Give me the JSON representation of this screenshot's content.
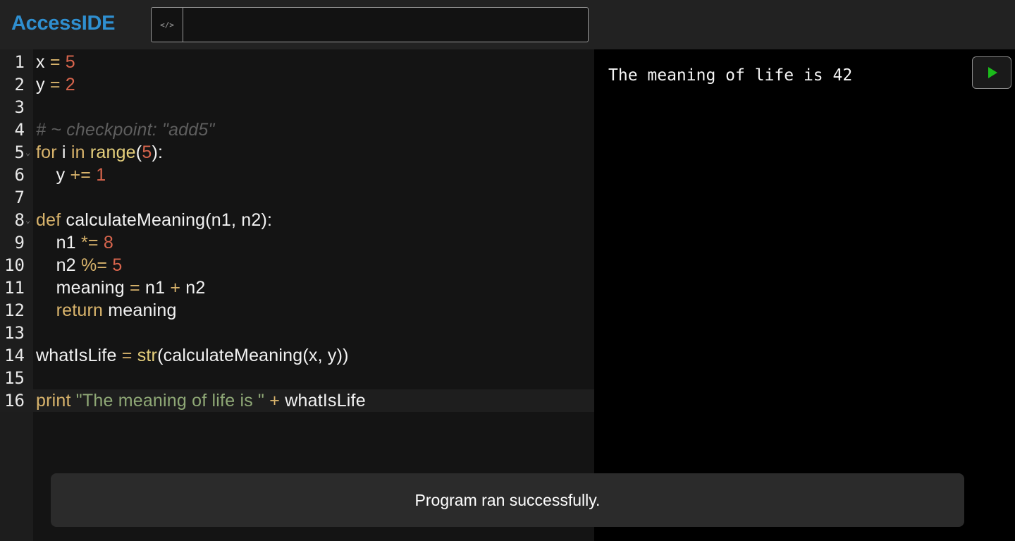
{
  "app": {
    "title": "AccessIDE"
  },
  "command_bar": {
    "icon": "code-icon",
    "icon_glyph": "</>",
    "value": "",
    "placeholder": ""
  },
  "editor": {
    "lines": [
      {
        "n": "1",
        "tokens": [
          {
            "t": "x",
            "c": "id"
          },
          {
            "t": " = ",
            "c": "op"
          },
          {
            "t": "5",
            "c": "num"
          }
        ]
      },
      {
        "n": "2",
        "tokens": [
          {
            "t": "y",
            "c": "id"
          },
          {
            "t": " = ",
            "c": "op"
          },
          {
            "t": "2",
            "c": "num"
          }
        ]
      },
      {
        "n": "3",
        "tokens": []
      },
      {
        "n": "4",
        "tokens": [
          {
            "t": "# ~ checkpoint: \"add5\"",
            "c": "com"
          }
        ]
      },
      {
        "n": "5",
        "fold": true,
        "tokens": [
          {
            "t": "for",
            "c": "kw"
          },
          {
            "t": " i ",
            "c": "id"
          },
          {
            "t": "in",
            "c": "kw"
          },
          {
            "t": " ",
            "c": "id"
          },
          {
            "t": "range",
            "c": "fn"
          },
          {
            "t": "(",
            "c": "id"
          },
          {
            "t": "5",
            "c": "num"
          },
          {
            "t": "):",
            "c": "id"
          }
        ]
      },
      {
        "n": "6",
        "tokens": [
          {
            "t": "    y ",
            "c": "id"
          },
          {
            "t": "+=",
            "c": "op"
          },
          {
            "t": " ",
            "c": "id"
          },
          {
            "t": "1",
            "c": "num"
          }
        ]
      },
      {
        "n": "7",
        "tokens": []
      },
      {
        "n": "8",
        "fold": true,
        "tokens": [
          {
            "t": "def",
            "c": "kw"
          },
          {
            "t": " calculateMeaning(n1, n2):",
            "c": "id"
          }
        ]
      },
      {
        "n": "9",
        "tokens": [
          {
            "t": "    n1 ",
            "c": "id"
          },
          {
            "t": "*=",
            "c": "op"
          },
          {
            "t": " ",
            "c": "id"
          },
          {
            "t": "8",
            "c": "num"
          }
        ]
      },
      {
        "n": "10",
        "tokens": [
          {
            "t": "    n2 ",
            "c": "id"
          },
          {
            "t": "%=",
            "c": "op"
          },
          {
            "t": " ",
            "c": "id"
          },
          {
            "t": "5",
            "c": "num"
          }
        ]
      },
      {
        "n": "11",
        "tokens": [
          {
            "t": "    meaning ",
            "c": "id"
          },
          {
            "t": "=",
            "c": "op"
          },
          {
            "t": " n1 ",
            "c": "id"
          },
          {
            "t": "+",
            "c": "op"
          },
          {
            "t": " n2",
            "c": "id"
          }
        ]
      },
      {
        "n": "12",
        "tokens": [
          {
            "t": "    ",
            "c": "id"
          },
          {
            "t": "return",
            "c": "kw"
          },
          {
            "t": " meaning",
            "c": "id"
          }
        ]
      },
      {
        "n": "13",
        "tokens": []
      },
      {
        "n": "14",
        "tokens": [
          {
            "t": "whatIsLife ",
            "c": "id"
          },
          {
            "t": "=",
            "c": "op"
          },
          {
            "t": " ",
            "c": "id"
          },
          {
            "t": "str",
            "c": "fn"
          },
          {
            "t": "(calculateMeaning(x, y))",
            "c": "id"
          }
        ]
      },
      {
        "n": "15",
        "tokens": []
      },
      {
        "n": "16",
        "active": true,
        "tokens": [
          {
            "t": "print",
            "c": "kw"
          },
          {
            "t": " ",
            "c": "id"
          },
          {
            "t": "\"The meaning of life is \"",
            "c": "str"
          },
          {
            "t": " ",
            "c": "id"
          },
          {
            "t": "+",
            "c": "op"
          },
          {
            "t": " whatIsLife",
            "c": "id"
          }
        ]
      }
    ]
  },
  "output": {
    "text": "The meaning of life is 42"
  },
  "run_button": {
    "icon": "play-icon",
    "color": "#1bbb1b"
  },
  "toast": {
    "message": "Program ran successfully."
  },
  "colors": {
    "brand": "#2f8fd0",
    "keyword": "#d9b46c",
    "number": "#d8654d",
    "string": "#8fa876"
  }
}
